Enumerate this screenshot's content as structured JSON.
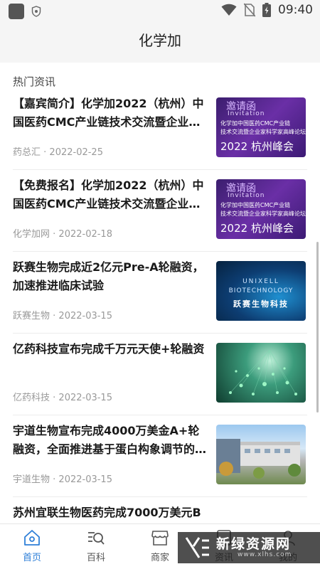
{
  "status_bar": {
    "time": "09:40"
  },
  "header": {
    "title": "化学加"
  },
  "section": {
    "title": "热门资讯"
  },
  "news": [
    {
      "title": "【嘉宾简介】化学加2022（杭州）中国医药CMC产业链技术交流暨企业…",
      "source": "药总汇",
      "date": "2022-02-25",
      "thumb": {
        "big": "邀请函",
        "sub": "Invitation",
        "line1": "化学加中国医药CMC产业链",
        "line2": "技术交流暨企业家科学家高峰论坛",
        "line3": "2022 杭州峰会"
      }
    },
    {
      "title": "【免费报名】化学加2022（杭州）中国医药CMC产业链技术交流暨企业…",
      "source": "化学加网",
      "date": "2022-02-18",
      "thumb": {
        "big": "邀请函",
        "sub": "Invitation",
        "line1": "化学加中国医药CMC产业链",
        "line2": "技术交流暨企业家科学家高峰论坛",
        "line3": "2022 杭州峰会"
      }
    },
    {
      "title": "跃赛生物完成近2亿元Pre-A轮融资，加速推进临床试验",
      "source": "跃赛生物",
      "date": "2022-03-15",
      "thumb": {
        "line1": "UNIXELL",
        "line2": "BIOTECHNOLOGY",
        "line3": "跃赛生物科技"
      }
    },
    {
      "title": "亿药科技宣布完成千万元天使+轮融资",
      "source": "亿药科技",
      "date": "2022-03-15"
    },
    {
      "title": "宇道生物宣布完成4000万美金A+轮融资，全面推进基于蛋白构象调节的…",
      "source": "宇道生物",
      "date": "2022-03-15"
    },
    {
      "title": "苏州宜联生物医药完成7000万美元B"
    }
  ],
  "tabs": [
    {
      "label": "首页",
      "icon": "home-icon",
      "active": true
    },
    {
      "label": "百科",
      "icon": "encyclopedia-search-icon"
    },
    {
      "label": "商家",
      "icon": "store-icon"
    },
    {
      "label": "资讯",
      "icon": "news-icon"
    },
    {
      "label": "我的",
      "icon": "profile-icon"
    }
  ],
  "watermark": {
    "text": "新绿资源网",
    "sub": "www.xlhs.com"
  },
  "colors": {
    "accent": "#2e7fd8",
    "header_bg": "#f5f5f5"
  }
}
